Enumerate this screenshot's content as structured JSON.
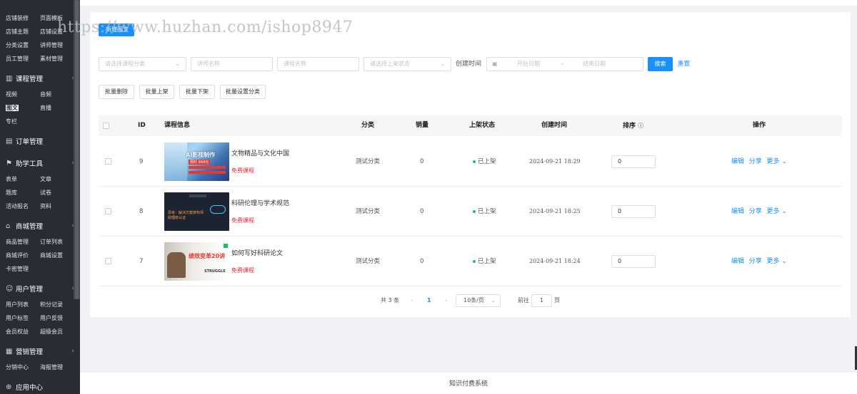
{
  "sidebar": {
    "top_items": [
      "店铺装修",
      "页面模板",
      "店铺主题",
      "店铺设置",
      "分类设置",
      "讲师管理",
      "员工管理",
      "素材管理"
    ],
    "course_group": "课程管理",
    "course_items": [
      "视频",
      "音频",
      "图文",
      "直播",
      "专栏"
    ],
    "order_group": "订单管理",
    "tools_group": "助学工具",
    "tools_items": [
      "表单",
      "文章",
      "题库",
      "试卷",
      "活动报名",
      "资料"
    ],
    "mall_group": "商城管理",
    "mall_items": [
      "商品管理",
      "订单列表",
      "商城评价",
      "商城设置",
      "卡密管理"
    ],
    "user_group": "用户管理",
    "user_items": [
      "用户列表",
      "积分记录",
      "用户标签",
      "用户反馈",
      "会员权益",
      "超级会员"
    ],
    "marketing_group": "营销管理",
    "marketing_items": [
      "分销中心",
      "海报管理"
    ],
    "app_group": "应用中心"
  },
  "watermark": "https://www.huzhan.com/ishop8947",
  "toolbar": {
    "new_label": "新增图文"
  },
  "filters": {
    "category_placeholder": "请选择课程分类",
    "teacher_placeholder": "讲师名称",
    "course_placeholder": "课程名称",
    "status_placeholder": "请选择上架状态",
    "created_label": "创建时间",
    "start_placeholder": "开始日期",
    "range_sep": "-",
    "end_placeholder": "结束日期",
    "search_label": "搜索",
    "reset_label": "重置"
  },
  "batch": [
    "批量删除",
    "批量上架",
    "批量下架",
    "批量设置分类"
  ],
  "table": {
    "headers": {
      "id": "ID",
      "info": "课程信息",
      "category": "分类",
      "sales": "销量",
      "status": "上架状态",
      "created": "创建时间",
      "sort": "排序",
      "ops": "操作"
    },
    "rows": [
      {
        "id": "9",
        "title": "文物精品与文化中国",
        "price": "免费课程",
        "category": "测试分类",
        "sales": "0",
        "status": "已上架",
        "created": "2024-09-21 18:29",
        "sort": "0",
        "thumb_text": "AI影视制作",
        "thumb_sub": "限时 999元"
      },
      {
        "id": "8",
        "title": "科研伦理与学术规范",
        "price": "免费课程",
        "category": "测试分类",
        "sales": "0",
        "status": "已上架",
        "created": "2024-09-21 18:25",
        "sort": "0",
        "thumb_text": "思考：解决方案架构师",
        "thumb_sub": "助理级认证"
      },
      {
        "id": "7",
        "title": "如何写好科研论文",
        "price": "免费课程",
        "category": "测试分类",
        "sales": "0",
        "status": "已上架",
        "created": "2024-09-21 18:24",
        "sort": "0",
        "thumb_text": "绩效变革20讲",
        "thumb_sub": "STRUGGLE"
      }
    ],
    "ops": {
      "edit": "编辑",
      "share": "分享",
      "more": "更多"
    }
  },
  "pagination": {
    "total": "共 3 条",
    "page": "1",
    "page_size": "10条/页",
    "goto_label": "前往",
    "goto_value": "1",
    "page_suffix": "页"
  },
  "footer": "知识付费系统",
  "colors": {
    "primary": "#1890ff",
    "sidebar": "#282c34",
    "danger": "#f5222d",
    "success": "#19be6b"
  }
}
